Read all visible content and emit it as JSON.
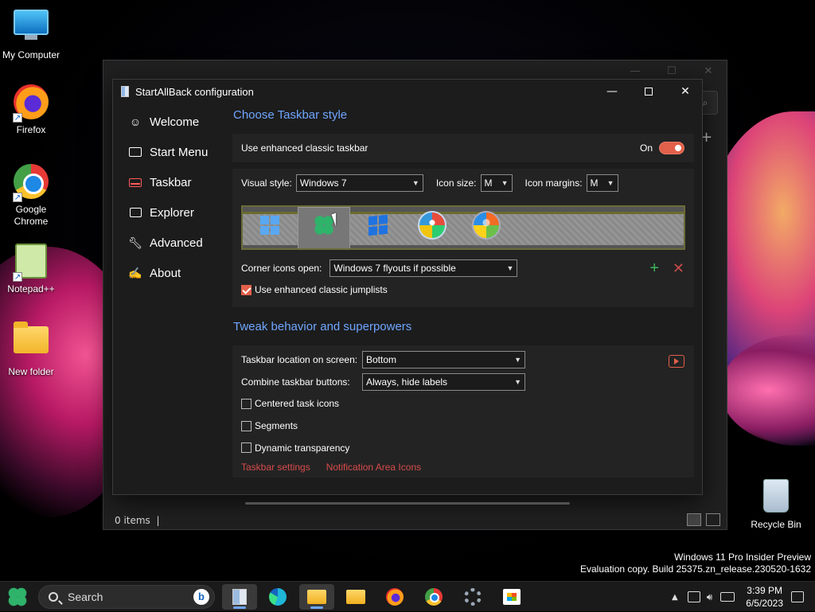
{
  "desktop": {
    "icons": [
      {
        "label": "My Computer"
      },
      {
        "label": "Firefox"
      },
      {
        "label": "Google Chrome"
      },
      {
        "label": "Notepad++"
      },
      {
        "label": "New folder"
      },
      {
        "label": "Recycle Bin"
      }
    ],
    "watermark": {
      "line1": "Windows 11 Pro Insider Preview",
      "line2": "Evaluation copy. Build 25375.zn_release.230520-1632"
    }
  },
  "explorer_bg": {
    "status": "0 items"
  },
  "window": {
    "title": "StartAllBack configuration",
    "nav": [
      {
        "label": "Welcome",
        "icon": "smile-icon"
      },
      {
        "label": "Start Menu",
        "icon": "keyboard-icon"
      },
      {
        "label": "Taskbar",
        "icon": "taskbar-icon",
        "active": true
      },
      {
        "label": "Explorer",
        "icon": "folder-icon"
      },
      {
        "label": "Advanced",
        "icon": "wrench-icon"
      },
      {
        "label": "About",
        "icon": "about-icon"
      }
    ]
  },
  "style_section": {
    "title": "Choose Taskbar style",
    "enhanced_label": "Use enhanced classic taskbar",
    "toggle_state": "On",
    "visual_style_label": "Visual style:",
    "visual_style_value": "Windows 7",
    "icon_size_label": "Icon size:",
    "icon_size_value": "M",
    "icon_margins_label": "Icon margins:",
    "icon_margins_value": "M",
    "start_buttons": [
      "windows-11-logo",
      "clover-logo",
      "windows-10-logo",
      "windows-7-orb",
      "windows-vista-orb"
    ],
    "selected_start_button": 1,
    "corner_label": "Corner icons open:",
    "corner_value": "Windows 7 flyouts if possible",
    "jumplists_label": "Use enhanced classic jumplists",
    "jumplists_checked": true
  },
  "tweak_section": {
    "title": "Tweak behavior and superpowers",
    "location_label": "Taskbar location on screen:",
    "location_value": "Bottom",
    "combine_label": "Combine taskbar buttons:",
    "combine_value": "Always, hide labels",
    "checks": [
      {
        "label": "Centered task icons",
        "checked": false
      },
      {
        "label": "Segments",
        "checked": false
      },
      {
        "label": "Dynamic transparency",
        "checked": false
      }
    ],
    "links": [
      "Taskbar settings",
      "Notification Area Icons"
    ]
  },
  "taskbar": {
    "search_placeholder": "Search",
    "clock_time": "3:39 PM",
    "clock_date": "6/5/2023",
    "apps": [
      "startallback",
      "edge",
      "file-explorer",
      "folder",
      "firefox",
      "chrome",
      "settings",
      "store"
    ]
  },
  "colors": {
    "accent": "#6fa6ff",
    "toggle": "#e2604a",
    "link": "#d84b4b",
    "add": "#3cb85a"
  }
}
